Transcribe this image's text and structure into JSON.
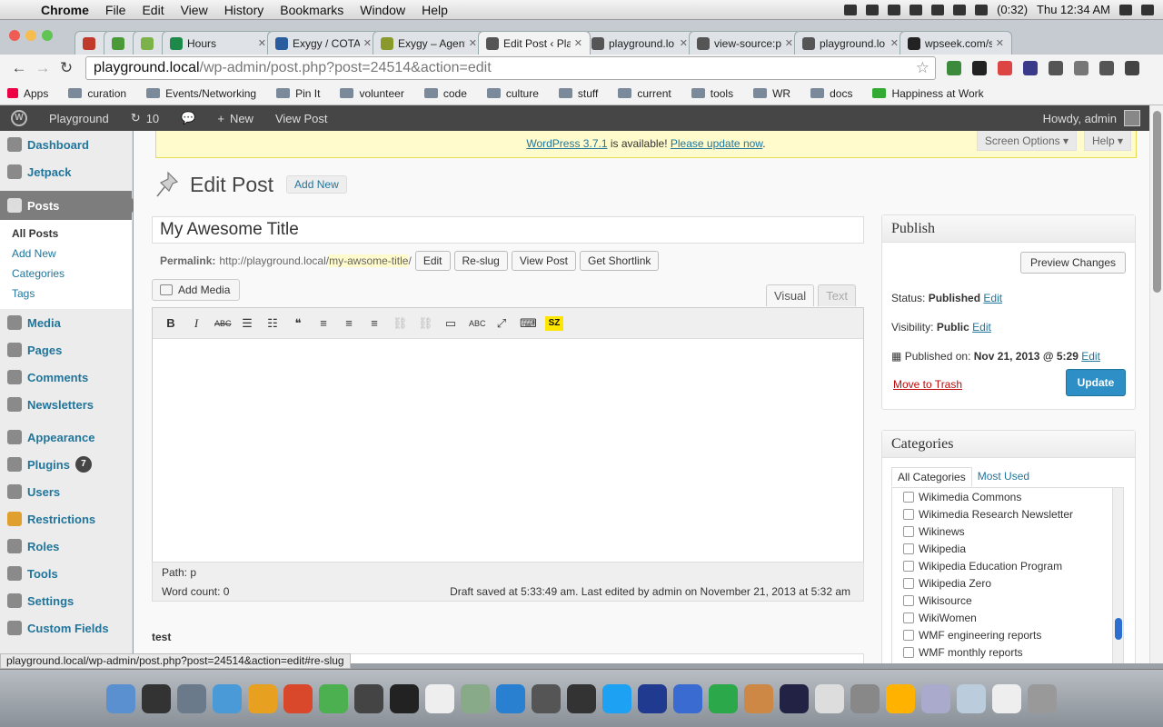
{
  "menubar": {
    "app": "Chrome",
    "items": [
      "File",
      "Edit",
      "View",
      "History",
      "Bookmarks",
      "Window",
      "Help"
    ],
    "battery": "(0:32)",
    "clock": "Thu 12:34 AM"
  },
  "tabs": [
    {
      "title": "",
      "color": "#c0392b"
    },
    {
      "title": "",
      "color": "#4a9a3a"
    },
    {
      "title": "",
      "color": "#7bb34a"
    },
    {
      "title": "Hours",
      "color": "#1e8a4a"
    },
    {
      "title": "Exygy / COTA",
      "color": "#2a5d9f"
    },
    {
      "title": "Exygy – Agent",
      "color": "#8a9a2a"
    },
    {
      "title": "Edit Post ‹ Play",
      "color": "#555"
    },
    {
      "title": "playground.lo",
      "color": "#555"
    },
    {
      "title": "view-source:p",
      "color": "#555"
    },
    {
      "title": "playground.lo",
      "color": "#555"
    },
    {
      "title": "wpseek.com/s",
      "color": "#222"
    }
  ],
  "address": {
    "domain": "playground.local",
    "path": "/wp-admin/post.php?post=24514&action=edit"
  },
  "bookmarks": [
    "Apps",
    "curation",
    "Events/Networking",
    "Pin It",
    "volunteer",
    "code",
    "culture",
    "stuff",
    "current",
    "tools",
    "WR",
    "docs",
    "Happiness at Work"
  ],
  "adminbar": {
    "site": "Playground",
    "updates": "10",
    "new": "New",
    "view": "View Post",
    "howdy": "Howdy, admin"
  },
  "sidebar": {
    "top": [
      "Dashboard",
      "Jetpack"
    ],
    "posts": "Posts",
    "submenu": [
      "All Posts",
      "Add New",
      "Categories",
      "Tags"
    ],
    "mid": [
      "Media",
      "Pages",
      "Comments",
      "Newsletters"
    ],
    "bottom": [
      "Appearance",
      "Plugins",
      "Users",
      "Restrictions",
      "Roles",
      "Tools",
      "Settings",
      "Custom Fields"
    ],
    "plugins_badge": "7"
  },
  "notice": {
    "link1": "WordPress 3.7.1",
    "text": " is available! ",
    "link2": "Please update now",
    "end": "."
  },
  "screen_options": "Screen Options ▾",
  "help": "Help ▾",
  "page": {
    "title": "Edit Post",
    "add_new": "Add New"
  },
  "post": {
    "title": "My Awesome Title"
  },
  "permalink": {
    "label": "Permalink:",
    "base": "http://playground.local/",
    "slug": "my-awsome-title",
    "end": "/",
    "buttons": [
      "Edit",
      "Re-slug",
      "View Post",
      "Get Shortlink"
    ]
  },
  "editor": {
    "add_media": "Add Media",
    "tab_visual": "Visual",
    "tab_text": "Text",
    "path": "Path: p",
    "word_count": "Word count: 0",
    "draft": "Draft saved at 5:33:49 am. Last edited by admin on November 21, 2013 at 5:32 am",
    "toolbar": [
      "B",
      "I",
      "ABC",
      "☰",
      "☷",
      "❝",
      "≡",
      "≡",
      "≡",
      "⛓",
      "⛓",
      "▭",
      "ABC",
      "⤢",
      "⌨",
      "SZ"
    ]
  },
  "below": {
    "label": "test"
  },
  "publish": {
    "heading": "Publish",
    "preview": "Preview Changes",
    "status_label": "Status:",
    "status": "Published",
    "visibility_label": "Visibility:",
    "visibility": "Public",
    "published_label": "Published on:",
    "published": "Nov 21, 2013 @ 5:29",
    "edit": "Edit",
    "trash": "Move to Trash",
    "update": "Update"
  },
  "categories": {
    "heading": "Categories",
    "tab_all": "All Categories",
    "tab_used": "Most Used",
    "items": [
      "Wikimedia Commons",
      "Wikimedia Research Newsletter",
      "Wikinews",
      "Wikipedia",
      "Wikipedia Education Program",
      "Wikipedia Zero",
      "Wikisource",
      "WikiWomen",
      "WMF engineering reports",
      "WMF monthly reports"
    ]
  },
  "status_url": "playground.local/wp-admin/post.php?post=24514&action=edit#re-slug",
  "dock_colors": [
    "#5a8fd0",
    "#333",
    "#6a7a8a",
    "#4a9ad8",
    "#e8a020",
    "#d9482b",
    "#4caf50",
    "#444",
    "#222",
    "#eee",
    "#8a8",
    "#2a80d0",
    "#555",
    "#333",
    "#1da1f2",
    "#1f3a8f",
    "#3a6bd0",
    "#2aa84a",
    "#c84",
    "#224",
    "#ddd",
    "#888",
    "#ffb300",
    "#aac",
    "#bcd",
    "#eee",
    "#999"
  ]
}
